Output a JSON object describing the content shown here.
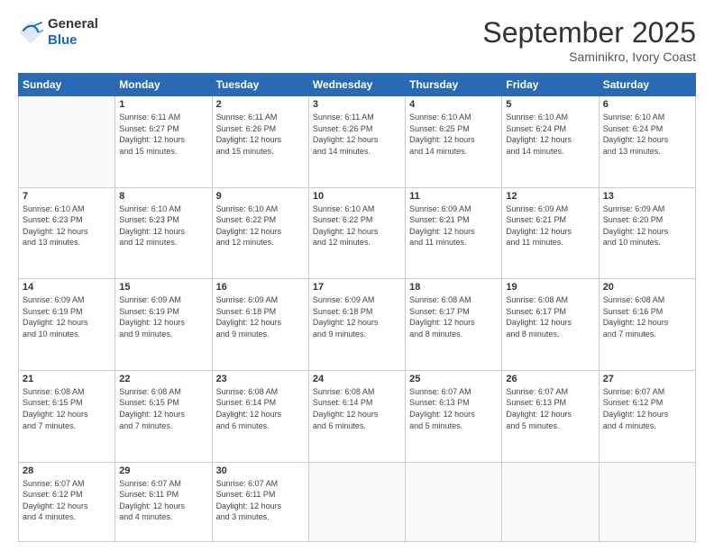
{
  "header": {
    "logo_general": "General",
    "logo_blue": "Blue",
    "month_title": "September 2025",
    "subtitle": "Saminikro, Ivory Coast"
  },
  "weekdays": [
    "Sunday",
    "Monday",
    "Tuesday",
    "Wednesday",
    "Thursday",
    "Friday",
    "Saturday"
  ],
  "weeks": [
    [
      {
        "day": "",
        "info": ""
      },
      {
        "day": "1",
        "info": "Sunrise: 6:11 AM\nSunset: 6:27 PM\nDaylight: 12 hours\nand 15 minutes."
      },
      {
        "day": "2",
        "info": "Sunrise: 6:11 AM\nSunset: 6:26 PM\nDaylight: 12 hours\nand 15 minutes."
      },
      {
        "day": "3",
        "info": "Sunrise: 6:11 AM\nSunset: 6:26 PM\nDaylight: 12 hours\nand 14 minutes."
      },
      {
        "day": "4",
        "info": "Sunrise: 6:10 AM\nSunset: 6:25 PM\nDaylight: 12 hours\nand 14 minutes."
      },
      {
        "day": "5",
        "info": "Sunrise: 6:10 AM\nSunset: 6:24 PM\nDaylight: 12 hours\nand 14 minutes."
      },
      {
        "day": "6",
        "info": "Sunrise: 6:10 AM\nSunset: 6:24 PM\nDaylight: 12 hours\nand 13 minutes."
      }
    ],
    [
      {
        "day": "7",
        "info": "Sunrise: 6:10 AM\nSunset: 6:23 PM\nDaylight: 12 hours\nand 13 minutes."
      },
      {
        "day": "8",
        "info": "Sunrise: 6:10 AM\nSunset: 6:23 PM\nDaylight: 12 hours\nand 12 minutes."
      },
      {
        "day": "9",
        "info": "Sunrise: 6:10 AM\nSunset: 6:22 PM\nDaylight: 12 hours\nand 12 minutes."
      },
      {
        "day": "10",
        "info": "Sunrise: 6:10 AM\nSunset: 6:22 PM\nDaylight: 12 hours\nand 12 minutes."
      },
      {
        "day": "11",
        "info": "Sunrise: 6:09 AM\nSunset: 6:21 PM\nDaylight: 12 hours\nand 11 minutes."
      },
      {
        "day": "12",
        "info": "Sunrise: 6:09 AM\nSunset: 6:21 PM\nDaylight: 12 hours\nand 11 minutes."
      },
      {
        "day": "13",
        "info": "Sunrise: 6:09 AM\nSunset: 6:20 PM\nDaylight: 12 hours\nand 10 minutes."
      }
    ],
    [
      {
        "day": "14",
        "info": "Sunrise: 6:09 AM\nSunset: 6:19 PM\nDaylight: 12 hours\nand 10 minutes."
      },
      {
        "day": "15",
        "info": "Sunrise: 6:09 AM\nSunset: 6:19 PM\nDaylight: 12 hours\nand 9 minutes."
      },
      {
        "day": "16",
        "info": "Sunrise: 6:09 AM\nSunset: 6:18 PM\nDaylight: 12 hours\nand 9 minutes."
      },
      {
        "day": "17",
        "info": "Sunrise: 6:09 AM\nSunset: 6:18 PM\nDaylight: 12 hours\nand 9 minutes."
      },
      {
        "day": "18",
        "info": "Sunrise: 6:08 AM\nSunset: 6:17 PM\nDaylight: 12 hours\nand 8 minutes."
      },
      {
        "day": "19",
        "info": "Sunrise: 6:08 AM\nSunset: 6:17 PM\nDaylight: 12 hours\nand 8 minutes."
      },
      {
        "day": "20",
        "info": "Sunrise: 6:08 AM\nSunset: 6:16 PM\nDaylight: 12 hours\nand 7 minutes."
      }
    ],
    [
      {
        "day": "21",
        "info": "Sunrise: 6:08 AM\nSunset: 6:15 PM\nDaylight: 12 hours\nand 7 minutes."
      },
      {
        "day": "22",
        "info": "Sunrise: 6:08 AM\nSunset: 6:15 PM\nDaylight: 12 hours\nand 7 minutes."
      },
      {
        "day": "23",
        "info": "Sunrise: 6:08 AM\nSunset: 6:14 PM\nDaylight: 12 hours\nand 6 minutes."
      },
      {
        "day": "24",
        "info": "Sunrise: 6:08 AM\nSunset: 6:14 PM\nDaylight: 12 hours\nand 6 minutes."
      },
      {
        "day": "25",
        "info": "Sunrise: 6:07 AM\nSunset: 6:13 PM\nDaylight: 12 hours\nand 5 minutes."
      },
      {
        "day": "26",
        "info": "Sunrise: 6:07 AM\nSunset: 6:13 PM\nDaylight: 12 hours\nand 5 minutes."
      },
      {
        "day": "27",
        "info": "Sunrise: 6:07 AM\nSunset: 6:12 PM\nDaylight: 12 hours\nand 4 minutes."
      }
    ],
    [
      {
        "day": "28",
        "info": "Sunrise: 6:07 AM\nSunset: 6:12 PM\nDaylight: 12 hours\nand 4 minutes."
      },
      {
        "day": "29",
        "info": "Sunrise: 6:07 AM\nSunset: 6:11 PM\nDaylight: 12 hours\nand 4 minutes."
      },
      {
        "day": "30",
        "info": "Sunrise: 6:07 AM\nSunset: 6:11 PM\nDaylight: 12 hours\nand 3 minutes."
      },
      {
        "day": "",
        "info": ""
      },
      {
        "day": "",
        "info": ""
      },
      {
        "day": "",
        "info": ""
      },
      {
        "day": "",
        "info": ""
      }
    ]
  ]
}
